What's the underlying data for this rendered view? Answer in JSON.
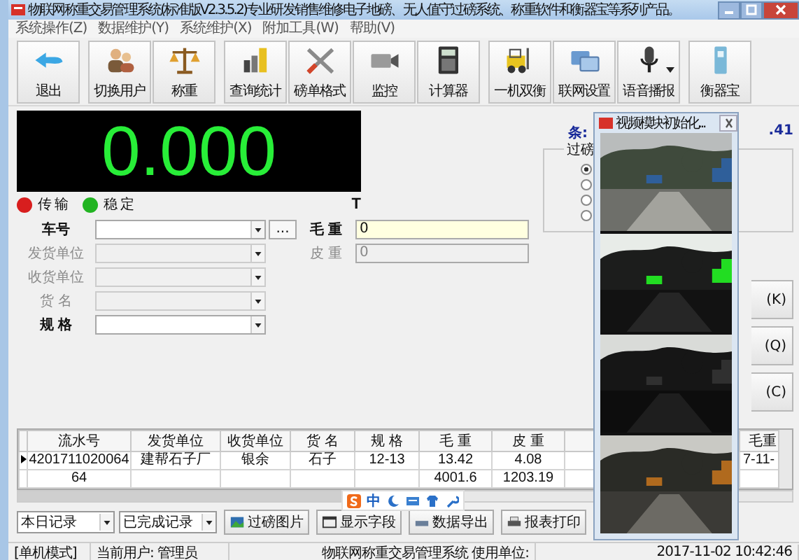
{
  "window": {
    "title": "物联网称重交易管理系统(标准版V2.3.5.2)专业研发销售维修电子地磅、无人值守过磅系统、称重软件和衡器宝等系列产品。"
  },
  "menu": [
    "系统操作(Z)",
    "数据维护(Y)",
    "系统维护(X)",
    "附加工具(W)",
    "帮助(V)"
  ],
  "toolbar": [
    {
      "label": "退出"
    },
    {
      "label": "切换用户"
    },
    {
      "label": "称重"
    },
    {
      "label": "查询统计"
    },
    {
      "label": "磅单格式"
    },
    {
      "label": "监控"
    },
    {
      "label": "计算器"
    },
    {
      "label": "一机双衡"
    },
    {
      "label": "联网设置"
    },
    {
      "label": "语音播报"
    },
    {
      "label": "衡器宝"
    }
  ],
  "display": {
    "reading": "0.000",
    "unit": "T"
  },
  "indicators": [
    {
      "label": "传输",
      "color": "#d81e1e"
    },
    {
      "label": "稳定",
      "color": "#22b422"
    }
  ],
  "form": [
    {
      "label": "车号",
      "disabled": false,
      "button": "...",
      "weight_label": "毛 重",
      "weight_value": "0",
      "weight_disabled": false
    },
    {
      "label": "发货单位",
      "disabled": true,
      "weight_label": "皮 重",
      "weight_value": "0",
      "weight_disabled": true
    },
    {
      "label": "收货单位",
      "disabled": true
    },
    {
      "label": "货 名",
      "disabled": true
    },
    {
      "label": "规 格",
      "disabled": false
    }
  ],
  "side": {
    "info_left": "条:",
    "info_right": ".41",
    "group_title": "过磅",
    "options": [
      {
        "selected": true
      },
      {
        "selected": false
      },
      {
        "selected": false
      },
      {
        "selected": false
      }
    ],
    "buttons": [
      "(K)",
      "(Q)",
      "(C)"
    ]
  },
  "table": {
    "columns": [
      "流水号",
      "发货单位",
      "收货单位",
      "货 名",
      "规 格",
      "毛 重",
      "皮 重",
      "毛重"
    ],
    "rows": [
      {
        "current": true,
        "cells": [
          "4201711020064",
          "建帮石子厂",
          "银余",
          "石子",
          "12-13",
          "13.42",
          "4.08",
          "7-11-"
        ]
      },
      {
        "current": false,
        "cells": [
          "64",
          null,
          null,
          null,
          null,
          "4001.6",
          "1203.19",
          null
        ]
      }
    ]
  },
  "ime": {
    "label": "中"
  },
  "filters": [
    "本日记录",
    "已完成记录"
  ],
  "actions": [
    {
      "label": "过磅图片"
    },
    {
      "label": "显示字段"
    },
    {
      "label": "数据导出"
    },
    {
      "label": "报表打印"
    }
  ],
  "video": {
    "title": "视频模块初始化..."
  },
  "status_bar": [
    "[单机模式]",
    "当前用户: 管理员",
    "物联网称重交易管理系统 使用单位:",
    "2017-11-02 10:42:46"
  ]
}
